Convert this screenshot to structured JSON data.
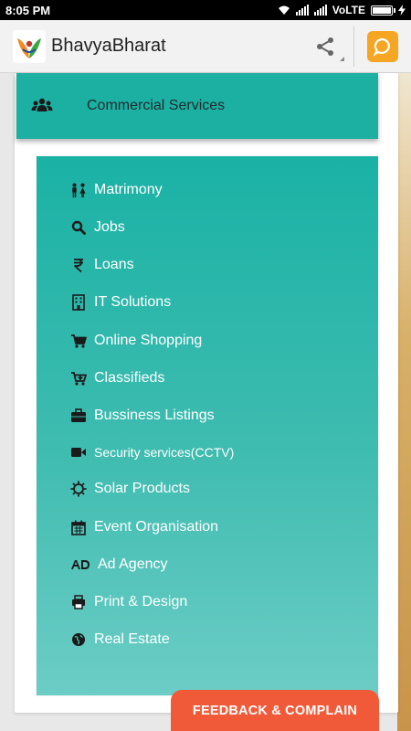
{
  "status_bar": {
    "time": "8:05 PM",
    "network": "VoLTE"
  },
  "app_bar": {
    "title": "BhavyaBharat",
    "icons": [
      "logo-icon",
      "share-icon",
      "chat-icon"
    ]
  },
  "section": {
    "title": "Commercial Services",
    "icon": "users-group-icon"
  },
  "menu": {
    "items": [
      {
        "label": "Matrimony",
        "icon": "couple-icon"
      },
      {
        "label": "Jobs",
        "icon": "search-icon"
      },
      {
        "label": "Loans",
        "icon": "rupee-icon"
      },
      {
        "label": "IT Solutions",
        "icon": "building-icon"
      },
      {
        "label": "Online Shopping",
        "icon": "cart-icon"
      },
      {
        "label": "Classifieds",
        "icon": "cart-plus-icon"
      },
      {
        "label": "Bussiness Listings",
        "icon": "briefcase-icon"
      },
      {
        "label": "Security services(CCTV)",
        "icon": "video-camera-icon"
      },
      {
        "label": "Solar Products",
        "icon": "sun-icon"
      },
      {
        "label": "Event Organisation",
        "icon": "calendar-icon"
      },
      {
        "label": "Ad Agency",
        "icon": "ad-icon"
      },
      {
        "label": "Print & Design",
        "icon": "printer-icon"
      },
      {
        "label": "Real Estate",
        "icon": "globe-icon"
      }
    ]
  },
  "feedback_button": {
    "label": "FEEDBACK & COMPLAIN"
  },
  "colors": {
    "teal": "#1cb0a3",
    "feedback": "#f15a38",
    "chat": "#f5a623"
  }
}
